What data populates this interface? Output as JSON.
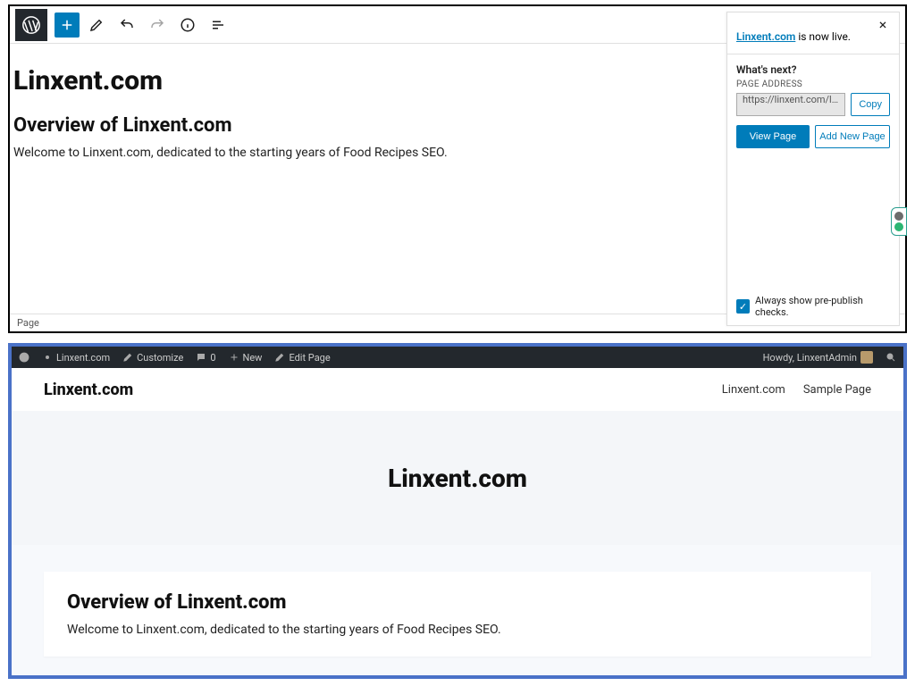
{
  "editor": {
    "page_title": "Linxent.com",
    "overview_heading": "Overview of Linxent.com",
    "body_text": "Welcome to Linxent.com, dedicated to the starting years of Food Recipes SEO.",
    "footer_breadcrumb": "Page"
  },
  "popover": {
    "site_link_text": "Linxent.com",
    "live_suffix": " is now live.",
    "whats_next": "What's next?",
    "page_address_label": "PAGE ADDRESS",
    "page_address_value": "https://linxent.com/linxent...",
    "copy_label": "Copy",
    "view_page_label": "View Page",
    "add_new_page_label": "Add New Page",
    "prepublish_label": "Always show pre-publish checks."
  },
  "adminbar": {
    "site_name": "Linxent.com",
    "customize": "Customize",
    "comments_count": "0",
    "new": "New",
    "edit_page": "Edit Page",
    "howdy": "Howdy, LinxentAdmin"
  },
  "site": {
    "title": "Linxent.com",
    "nav": {
      "item1": "Linxent.com",
      "item2": "Sample Page"
    },
    "hero_title": "Linxent.com",
    "card_heading": "Overview of Linxent.com",
    "card_body": "Welcome to Linxent.com, dedicated to the starting years of Food Recipes SEO."
  }
}
